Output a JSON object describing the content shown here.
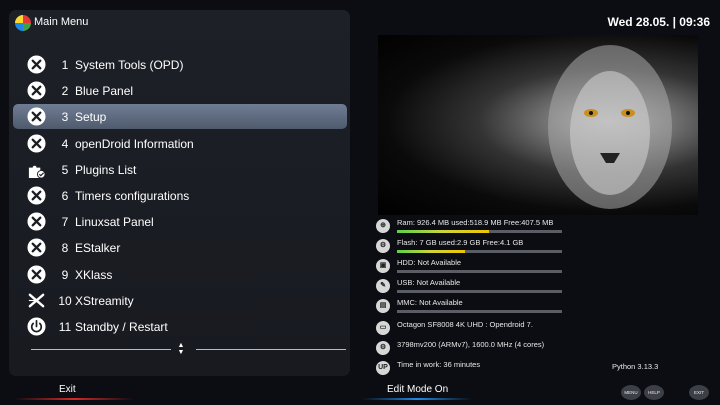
{
  "header": {
    "title": "Main Menu",
    "datetime": "Wed 28.05. | 09:36"
  },
  "menu": {
    "items": [
      {
        "number": "1",
        "label": "System Tools (OPD)",
        "icon": "close-circle-icon",
        "selected": false
      },
      {
        "number": "2",
        "label": "Blue Panel",
        "icon": "close-circle-icon",
        "selected": false
      },
      {
        "number": "3",
        "label": "Setup",
        "icon": "close-circle-icon",
        "selected": true
      },
      {
        "number": "4",
        "label": "openDroid Information",
        "icon": "close-circle-icon",
        "selected": false
      },
      {
        "number": "5",
        "label": "Plugins List",
        "icon": "puzzle-icon",
        "selected": false
      },
      {
        "number": "6",
        "label": "Timers configurations",
        "icon": "close-circle-icon",
        "selected": false
      },
      {
        "number": "7",
        "label": "Linuxsat Panel",
        "icon": "close-circle-icon",
        "selected": false
      },
      {
        "number": "8",
        "label": "EStalker",
        "icon": "close-circle-icon",
        "selected": false
      },
      {
        "number": "9",
        "label": "XKlass",
        "icon": "close-circle-icon",
        "selected": false
      },
      {
        "number": "10",
        "label": "XStreamity",
        "icon": "xstreamity-icon",
        "selected": false
      },
      {
        "number": "11",
        "label": "Standby / Restart",
        "icon": "power-icon",
        "selected": false
      }
    ]
  },
  "sysinfo": [
    {
      "icon": "ram-icon",
      "text": "Ram: 926.4 MB used:518.9 MB Free:407.5 MB",
      "usage": 0.56
    },
    {
      "icon": "flash-icon",
      "text": "Flash: 7 GB used:2.9 GB Free:4.1 GB",
      "usage": 0.41
    },
    {
      "icon": "hdd-icon",
      "text": "HDD: Not Available",
      "usage": 0
    },
    {
      "icon": "usb-icon",
      "text": "USB: Not Available",
      "usage": 0
    },
    {
      "icon": "mmc-icon",
      "text": "MMC: Not Available",
      "usage": 0
    },
    {
      "icon": "receiver-icon",
      "text": "Octagon SF8008 4K UHD : Opendroid 7."
    },
    {
      "icon": "cpu-icon",
      "text": "3798mv200 (ARMv7), 1600.0 MHz (4 cores)"
    },
    {
      "icon": "uptime-icon",
      "text": "Time in work: 36 minutes",
      "icon_text": "UP"
    }
  ],
  "python_version": "Python 3.13.3",
  "footer": {
    "exit_label": "Exit",
    "edit_label": "Edit Mode On",
    "buttons": [
      "MENU",
      "HELP",
      "EXIT"
    ]
  },
  "colors": {
    "selection": "#5f6b7f",
    "bar_green": "#5bd14b",
    "bar_yellow": "#f0c400",
    "exit_accent": "#d62828",
    "edit_accent": "#1e88e5"
  }
}
